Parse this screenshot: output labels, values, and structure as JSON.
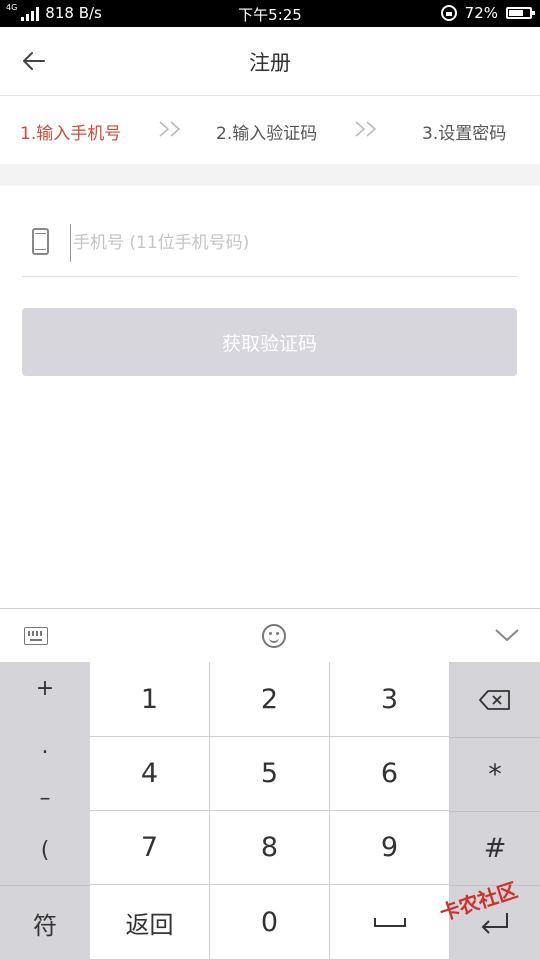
{
  "status_bar": {
    "network_speed": "818  B/s",
    "net_type": "4G",
    "time": "下午5:25",
    "battery": "72%",
    "battery_level": 0.72
  },
  "header": {
    "title": "注册"
  },
  "steps": [
    {
      "label": "1.输入手机号",
      "active": true
    },
    {
      "label": "2.输入验证码",
      "active": false
    },
    {
      "label": "3.设置密码",
      "active": false
    }
  ],
  "form": {
    "phone_placeholder": "手机号 (11位手机号码)",
    "phone_value": "",
    "get_code_label": "获取验证码"
  },
  "keyboard": {
    "side_left": [
      "+",
      ".",
      "–",
      "(",
      "符"
    ],
    "digits": [
      [
        "1",
        "2",
        "3"
      ],
      [
        "4",
        "5",
        "6"
      ],
      [
        "7",
        "8",
        "9"
      ],
      [
        "返回",
        "0",
        "␣"
      ]
    ],
    "side_right": [
      "⌫",
      "*",
      "#",
      "↵"
    ]
  },
  "watermark": "卡农社区",
  "colors": {
    "accent": "#d14a3b",
    "button_disabled": "#d6d6dc",
    "keyboard_bg": "#cfcfd4"
  }
}
